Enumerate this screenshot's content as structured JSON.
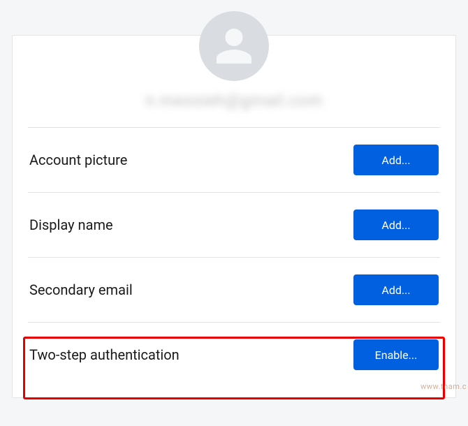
{
  "account": {
    "email_masked": "n.messieh@gmail.com"
  },
  "rows": {
    "account_picture": {
      "label": "Account picture",
      "button": "Add..."
    },
    "display_name": {
      "label": "Display name",
      "button": "Add..."
    },
    "secondary_email": {
      "label": "Secondary email",
      "button": "Add..."
    },
    "two_step_auth": {
      "label": "Two-step authentication",
      "button": "Enable..."
    }
  },
  "watermark": "www.tnam.c"
}
